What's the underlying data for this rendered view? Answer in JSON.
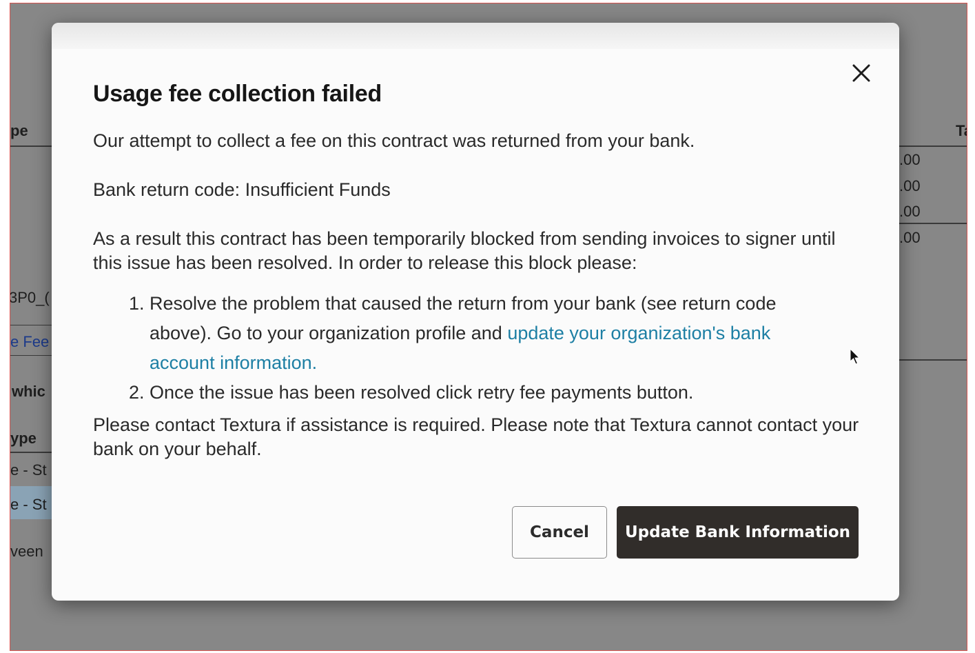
{
  "background": {
    "left_col": {
      "header": "pe",
      "ref": "3P0_(",
      "fee_link": "e Fee",
      "which": "whic",
      "type_header": "ype",
      "row1": "e - St",
      "row2": "e - St",
      "between": "veen"
    },
    "right_col": {
      "header": "Ta",
      "amounts": [
        ".00",
        ".00",
        ".00",
        ".00"
      ]
    }
  },
  "dialog": {
    "title": "Usage fee collection failed",
    "intro": "Our attempt to collect a fee on this contract was returned from your bank.",
    "return_code": "Bank return code: Insufficient Funds",
    "result": "As a result this contract has been temporarily blocked from sending invoices to signer until this issue has been resolved. In order to release this block please:",
    "steps": {
      "step1_text": "Resolve the problem that caused the return from your bank (see return code above). Go to your organization profile and ",
      "step1_link": "update your organization's bank account information.",
      "step2_text": "Once the issue has been resolved click retry fee payments button."
    },
    "contact": "Please contact Textura if assistance is required. Please note that Textura cannot contact your bank on your behalf.",
    "cancel_label": "Cancel",
    "primary_label": "Update Bank Information",
    "close_icon": "close-icon"
  },
  "colors": {
    "primary_button": "#312d2a",
    "link": "#1d7fa4",
    "frame_border": "#d9534f"
  }
}
